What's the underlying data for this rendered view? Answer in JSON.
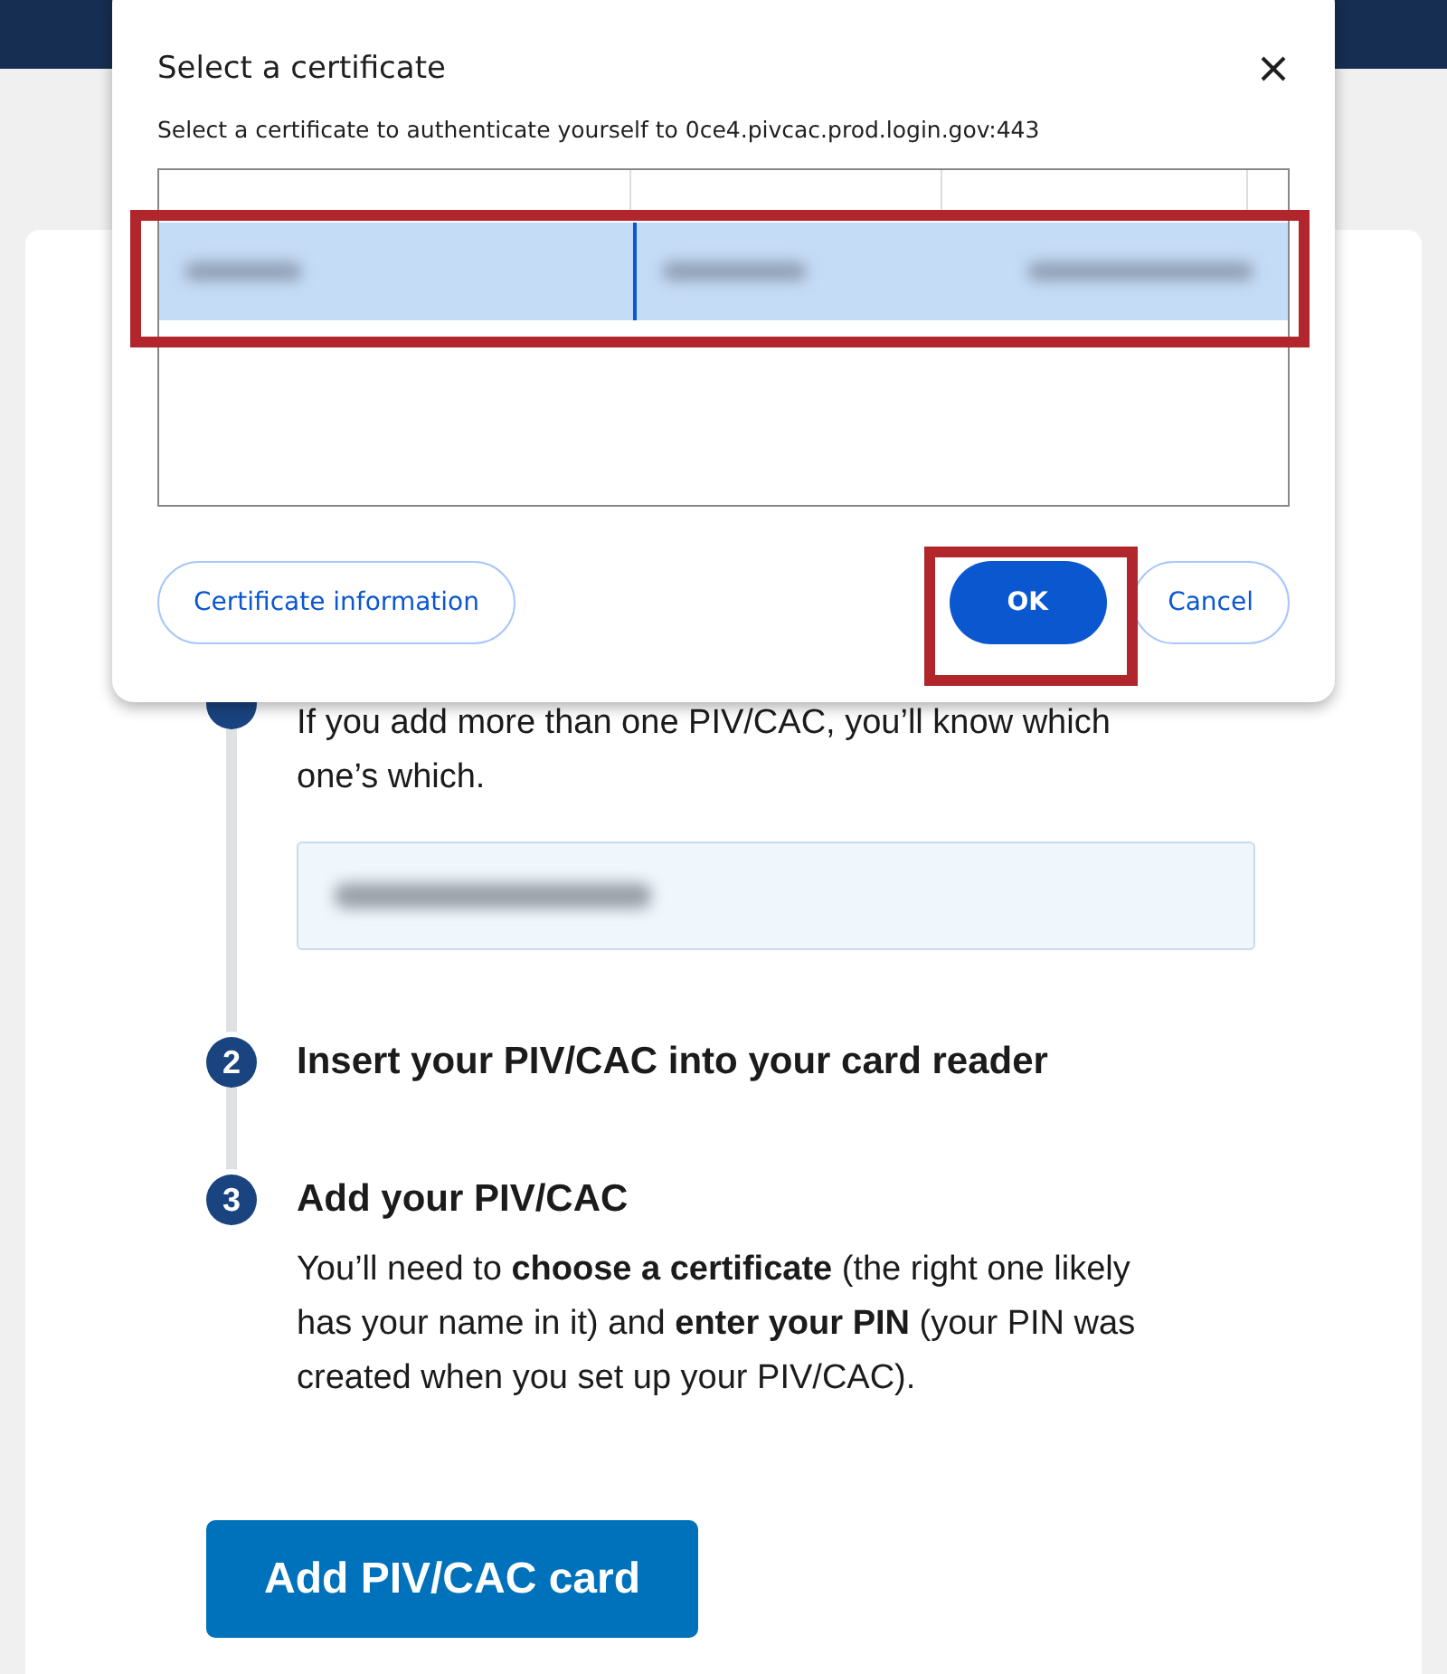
{
  "dialog": {
    "title": "Select a certificate",
    "subtitle": "Select a certificate to authenticate yourself to 0ce4.pivcac.prod.login.gov:443",
    "certificates": [
      {
        "selected": true
      }
    ],
    "buttons": [
      {
        "label": "Certificate information",
        "kind": "outline"
      },
      {
        "label": "OK",
        "kind": "primary"
      },
      {
        "label": "Cancel",
        "kind": "outline"
      }
    ]
  },
  "steps": [
    {
      "text": "If you add more than one PIV/CAC, you’ll know which one’s which.",
      "has_field": true
    },
    {
      "number": "2",
      "title": "Insert your PIV/CAC into your card reader",
      "has_field": false
    },
    {
      "number": "3",
      "title": "Add your PIV/CAC",
      "text": "You’ll need to **choose a certificate** (the right one likely has your name in it) and **enter your PIN** (your PIN was created when you set up your PIV/CAC).",
      "has_field": false
    }
  ],
  "submit_button": "Add PIV/CAC card"
}
